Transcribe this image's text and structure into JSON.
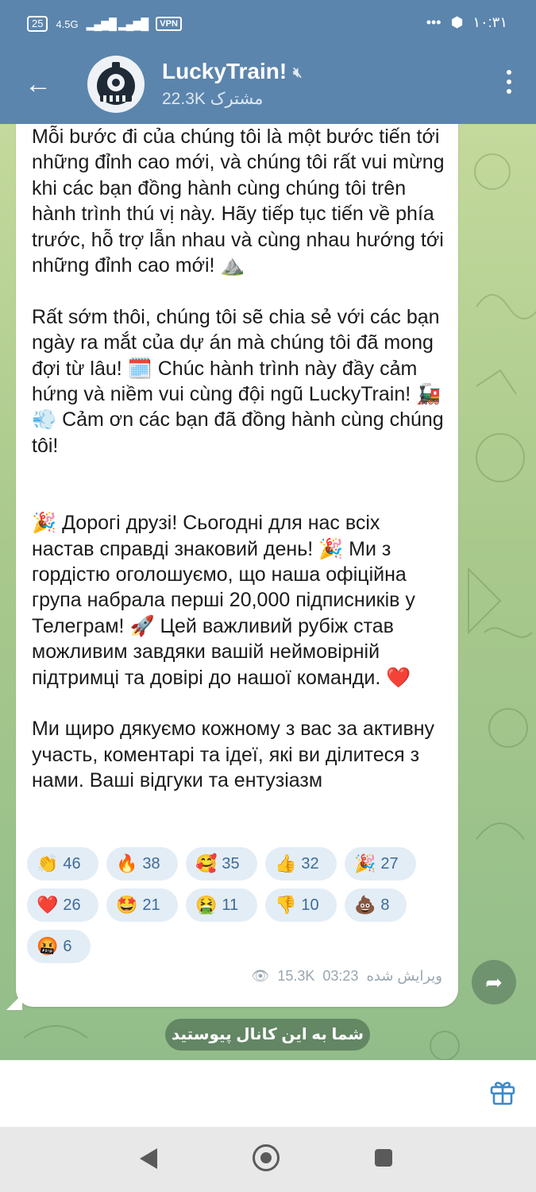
{
  "status_bar": {
    "battery": "25",
    "network": "4.5G",
    "vpn": "VPN",
    "time": "۱۰:۳۱"
  },
  "header": {
    "channel_name": "LuckyTrain!",
    "subscribers": "22.3K مشترک"
  },
  "message": {
    "text": "Mỗi bước đi của chúng tôi là một bước tiến tới những đỉnh cao mới, và chúng tôi rất vui mừng khi các bạn đồng hành cùng chúng tôi trên hành trình thú vị này. Hãy tiếp tục tiến về phía trước, hỗ trợ lẫn nhau và cùng nhau hướng tới những đỉnh cao mới! ⛰️\n\nRất sớm thôi, chúng tôi sẽ chia sẻ với các bạn ngày ra mắt của dự án mà chúng tôi đã mong đợi từ lâu! 🗓️ Chúc hành trình này đầy cảm hứng và niềm vui cùng đội ngũ LuckyTrain! 🚂💨 Cảm ơn các bạn đã đồng hành cùng chúng tôi!\n\n\n🎉 Дорогі друзі! Сьогодні для нас всіх настав справді знаковий день! 🎉 Ми з гордістю оголошуємо, що наша офіційна група набрала перші 20,000 підписників у Телеграм! 🚀 Цей важливий рубіж став можливим завдяки вашій неймовірній підтримці та довірі до нашої команди. ❤️\n\nМи щиро дякуємо кожному з вас за активну участь, коментарі та ідеї, які ви ділитеся з нами. Ваші відгуки та ентузіазм",
    "views": "15.3K",
    "time": "03:23",
    "edited_label": "ویرایش شده"
  },
  "reactions": [
    {
      "emoji": "👏",
      "count": "46"
    },
    {
      "emoji": "🔥",
      "count": "38"
    },
    {
      "emoji": "🥰",
      "count": "35"
    },
    {
      "emoji": "👍",
      "count": "32"
    },
    {
      "emoji": "🎉",
      "count": "27"
    },
    {
      "emoji": "❤️",
      "count": "26"
    },
    {
      "emoji": "🤩",
      "count": "21"
    },
    {
      "emoji": "🤮",
      "count": "11"
    },
    {
      "emoji": "👎",
      "count": "10"
    },
    {
      "emoji": "💩",
      "count": "8"
    },
    {
      "emoji": "🤬",
      "count": "6"
    }
  ],
  "join_notice": "شما به این کانال پیوستید",
  "icons": {
    "back": "arrow-left-icon",
    "mute": "mute-icon",
    "menu": "more-vertical-icon",
    "share": "share-icon",
    "gift": "gift-icon",
    "views": "eye-icon"
  },
  "colors": {
    "header": "#5b85ad",
    "reaction_bg": "#e3edf6",
    "reaction_text": "#3e6b98"
  }
}
